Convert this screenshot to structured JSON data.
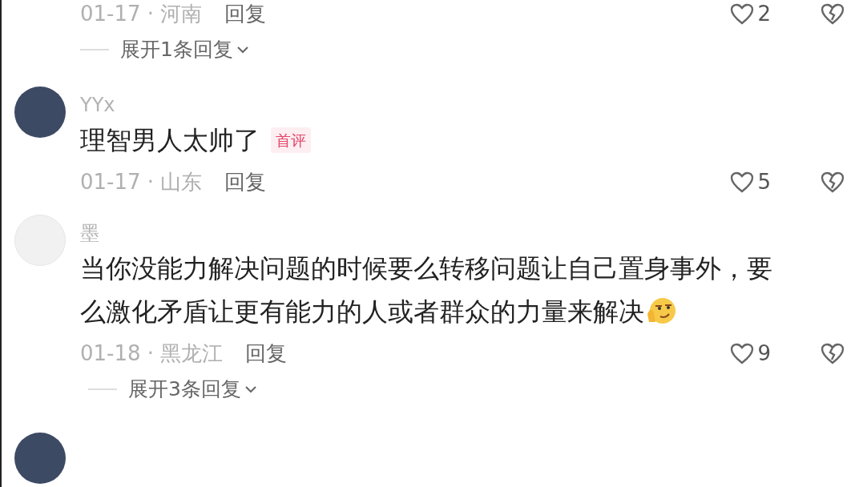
{
  "comments": [
    {
      "kind": "tail",
      "meta": "01-17 · 河南",
      "reply_label": "回复",
      "likes": "2",
      "expand_label": "展开1条回复"
    },
    {
      "kind": "full",
      "avatar": {
        "kind": "photo"
      },
      "username": "YYx",
      "lines": [
        "理智男人太帅了"
      ],
      "badge": "首评",
      "has_emoji": false,
      "meta": "01-17 · 山东",
      "reply_label": "回复",
      "likes": "5"
    },
    {
      "kind": "full",
      "avatar": {
        "kind": "blank"
      },
      "username": "墨",
      "lines": [
        "当你没能力解决问题的时候要么转移问题让自己置身事外，要",
        "么激化矛盾让更有能力的人或者群众的力量来解决"
      ],
      "has_emoji": true,
      "meta": "01-18 · 黑龙江",
      "reply_label": "回复",
      "likes": "9",
      "expand_label": "展开3条回复"
    },
    {
      "kind": "avatar_only",
      "avatar": {
        "kind": "photo"
      }
    }
  ]
}
